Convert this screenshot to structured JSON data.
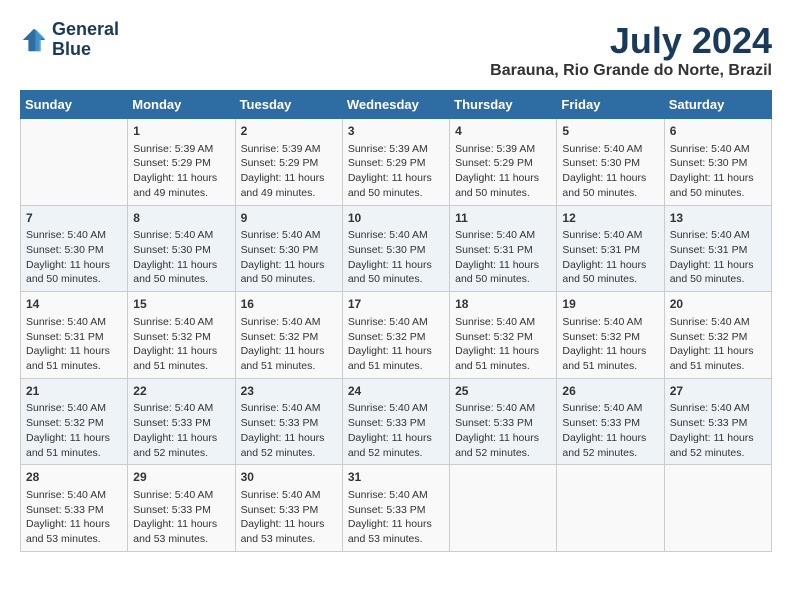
{
  "logo": {
    "line1": "General",
    "line2": "Blue"
  },
  "title": "July 2024",
  "location": "Barauna, Rio Grande do Norte, Brazil",
  "headers": [
    "Sunday",
    "Monday",
    "Tuesday",
    "Wednesday",
    "Thursday",
    "Friday",
    "Saturday"
  ],
  "weeks": [
    [
      {
        "day": "",
        "info": ""
      },
      {
        "day": "1",
        "info": "Sunrise: 5:39 AM\nSunset: 5:29 PM\nDaylight: 11 hours\nand 49 minutes."
      },
      {
        "day": "2",
        "info": "Sunrise: 5:39 AM\nSunset: 5:29 PM\nDaylight: 11 hours\nand 49 minutes."
      },
      {
        "day": "3",
        "info": "Sunrise: 5:39 AM\nSunset: 5:29 PM\nDaylight: 11 hours\nand 50 minutes."
      },
      {
        "day": "4",
        "info": "Sunrise: 5:39 AM\nSunset: 5:29 PM\nDaylight: 11 hours\nand 50 minutes."
      },
      {
        "day": "5",
        "info": "Sunrise: 5:40 AM\nSunset: 5:30 PM\nDaylight: 11 hours\nand 50 minutes."
      },
      {
        "day": "6",
        "info": "Sunrise: 5:40 AM\nSunset: 5:30 PM\nDaylight: 11 hours\nand 50 minutes."
      }
    ],
    [
      {
        "day": "7",
        "info": "Sunrise: 5:40 AM\nSunset: 5:30 PM\nDaylight: 11 hours\nand 50 minutes."
      },
      {
        "day": "8",
        "info": "Sunrise: 5:40 AM\nSunset: 5:30 PM\nDaylight: 11 hours\nand 50 minutes."
      },
      {
        "day": "9",
        "info": "Sunrise: 5:40 AM\nSunset: 5:30 PM\nDaylight: 11 hours\nand 50 minutes."
      },
      {
        "day": "10",
        "info": "Sunrise: 5:40 AM\nSunset: 5:30 PM\nDaylight: 11 hours\nand 50 minutes."
      },
      {
        "day": "11",
        "info": "Sunrise: 5:40 AM\nSunset: 5:31 PM\nDaylight: 11 hours\nand 50 minutes."
      },
      {
        "day": "12",
        "info": "Sunrise: 5:40 AM\nSunset: 5:31 PM\nDaylight: 11 hours\nand 50 minutes."
      },
      {
        "day": "13",
        "info": "Sunrise: 5:40 AM\nSunset: 5:31 PM\nDaylight: 11 hours\nand 50 minutes."
      }
    ],
    [
      {
        "day": "14",
        "info": "Sunrise: 5:40 AM\nSunset: 5:31 PM\nDaylight: 11 hours\nand 51 minutes."
      },
      {
        "day": "15",
        "info": "Sunrise: 5:40 AM\nSunset: 5:32 PM\nDaylight: 11 hours\nand 51 minutes."
      },
      {
        "day": "16",
        "info": "Sunrise: 5:40 AM\nSunset: 5:32 PM\nDaylight: 11 hours\nand 51 minutes."
      },
      {
        "day": "17",
        "info": "Sunrise: 5:40 AM\nSunset: 5:32 PM\nDaylight: 11 hours\nand 51 minutes."
      },
      {
        "day": "18",
        "info": "Sunrise: 5:40 AM\nSunset: 5:32 PM\nDaylight: 11 hours\nand 51 minutes."
      },
      {
        "day": "19",
        "info": "Sunrise: 5:40 AM\nSunset: 5:32 PM\nDaylight: 11 hours\nand 51 minutes."
      },
      {
        "day": "20",
        "info": "Sunrise: 5:40 AM\nSunset: 5:32 PM\nDaylight: 11 hours\nand 51 minutes."
      }
    ],
    [
      {
        "day": "21",
        "info": "Sunrise: 5:40 AM\nSunset: 5:32 PM\nDaylight: 11 hours\nand 51 minutes."
      },
      {
        "day": "22",
        "info": "Sunrise: 5:40 AM\nSunset: 5:33 PM\nDaylight: 11 hours\nand 52 minutes."
      },
      {
        "day": "23",
        "info": "Sunrise: 5:40 AM\nSunset: 5:33 PM\nDaylight: 11 hours\nand 52 minutes."
      },
      {
        "day": "24",
        "info": "Sunrise: 5:40 AM\nSunset: 5:33 PM\nDaylight: 11 hours\nand 52 minutes."
      },
      {
        "day": "25",
        "info": "Sunrise: 5:40 AM\nSunset: 5:33 PM\nDaylight: 11 hours\nand 52 minutes."
      },
      {
        "day": "26",
        "info": "Sunrise: 5:40 AM\nSunset: 5:33 PM\nDaylight: 11 hours\nand 52 minutes."
      },
      {
        "day": "27",
        "info": "Sunrise: 5:40 AM\nSunset: 5:33 PM\nDaylight: 11 hours\nand 52 minutes."
      }
    ],
    [
      {
        "day": "28",
        "info": "Sunrise: 5:40 AM\nSunset: 5:33 PM\nDaylight: 11 hours\nand 53 minutes."
      },
      {
        "day": "29",
        "info": "Sunrise: 5:40 AM\nSunset: 5:33 PM\nDaylight: 11 hours\nand 53 minutes."
      },
      {
        "day": "30",
        "info": "Sunrise: 5:40 AM\nSunset: 5:33 PM\nDaylight: 11 hours\nand 53 minutes."
      },
      {
        "day": "31",
        "info": "Sunrise: 5:40 AM\nSunset: 5:33 PM\nDaylight: 11 hours\nand 53 minutes."
      },
      {
        "day": "",
        "info": ""
      },
      {
        "day": "",
        "info": ""
      },
      {
        "day": "",
        "info": ""
      }
    ]
  ]
}
